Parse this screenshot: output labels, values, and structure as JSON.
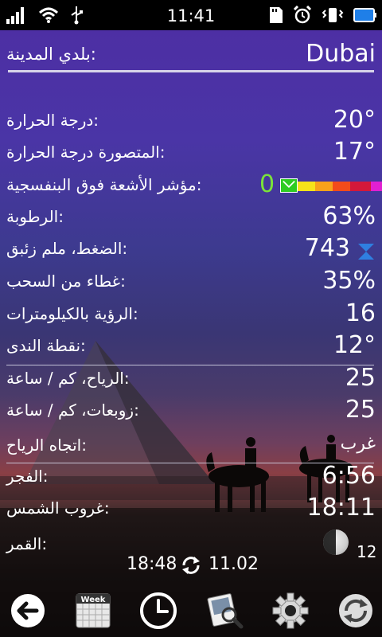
{
  "status_bar": {
    "time": "11:41"
  },
  "city": {
    "label": "بلدي المدينة:",
    "name": "Dubai"
  },
  "weather": {
    "temperature": {
      "label": "درجة الحرارة:",
      "value": "20°"
    },
    "feels_like": {
      "label": "المتصورة درجة الحرارة:",
      "value": "17°"
    },
    "uv_index": {
      "label": "مؤشر الأشعة فوق البنفسجية:",
      "value": "0",
      "scale_colors": [
        "#2ecc22",
        "#f5e31a",
        "#f7a21b",
        "#f24b1a",
        "#d4183a",
        "#e21fd2"
      ]
    },
    "humidity": {
      "label": "الرطوبة:",
      "value": "63%"
    },
    "pressure": {
      "label": "الضغط، ملم زئبق:",
      "value": "743"
    },
    "cloud_cover": {
      "label": "غطاء من السحب:",
      "value": "35%"
    },
    "visibility": {
      "label": "الرؤية بالكيلومترات:",
      "value": "16"
    },
    "dew_point": {
      "label": "نقطة الندى:",
      "value": "12°"
    },
    "wind": {
      "label": "الرياح، كم / ساعة:",
      "value": "25"
    },
    "gusts": {
      "label": "زوبعات، كم / ساعة:",
      "value": "25"
    },
    "wind_direction": {
      "label": "اتجاه الرياح:",
      "value": "غرب"
    },
    "sunrise": {
      "label": "الفجر:",
      "value": "6:56"
    },
    "sunset": {
      "label": "غروب الشمس:",
      "value": "18:11"
    },
    "moon": {
      "label": "القمر:",
      "value": "12"
    }
  },
  "update": {
    "time": "18:48",
    "date": "11.02"
  },
  "toolbar": {
    "week_label": "Week",
    "pressure_icon_color": "#2f7fe0"
  }
}
